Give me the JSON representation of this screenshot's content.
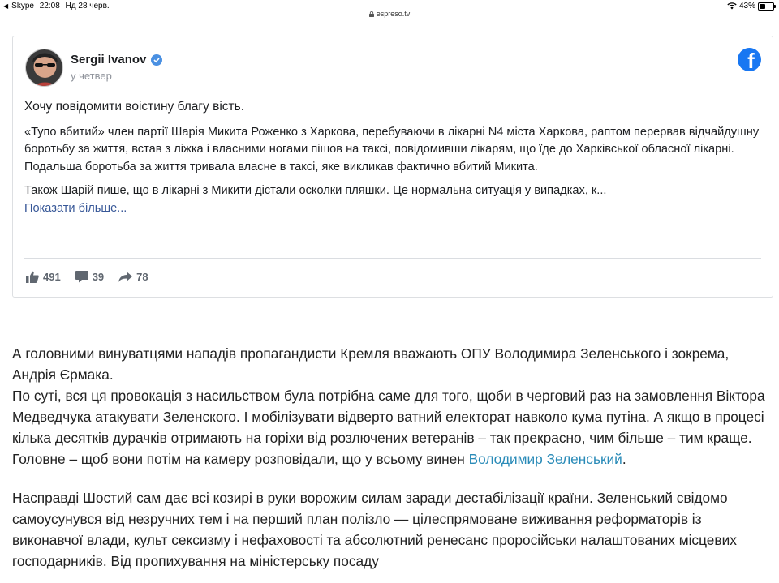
{
  "status_bar": {
    "back_app": "Skype",
    "time": "22:08",
    "date": "Нд 28 черв.",
    "battery": "43%",
    "url": "espreso.tv"
  },
  "fb_post": {
    "author": "Sergii Ivanov",
    "timestamp": "у четвер",
    "lead": "Хочу повідомити воістину благу вість.",
    "paragraph1": "«Тупо вбитий» член партії Шарія Микита Роженко з Харкова, перебуваючи в лікарні N4 міста Харкова, раптом перервав відчайдушну боротьбу за життя, встав з ліжка і власними ногами пішов на таксі, повідомивши лікарям, що їде до Харківської обласної лікарні. Подальша боротьба за життя тривала власне в таксі, яке викликав фактично вбитий Микита.",
    "paragraph2": "Також Шарій пише, що в лікарні з Микити дістали осколки пляшки. Це нормальна ситуація у випадках, к...",
    "show_more": "Показати більше...",
    "likes": "491",
    "comments": "39",
    "shares": "78",
    "brand_color": "#1877f2"
  },
  "article": {
    "p1_line1": "А головними винуватцями нападів пропагандисти Кремля вважають ОПУ Володимира Зеленського і зокрема, Андрія Єрмака.",
    "p1_rest": "По суті, вся ця провокація з насильством була потрібна саме для того, щоби в черговий раз на замовлення Віктора Медведчука атакувати Зеленского. І мобілізувати відверто ватний електорат навколо кума путіна. А якщо в процесі кілька десятків дурачків отримають на горіхи від розлючених ветеранів – так прекрасно, чим більше – тим краще. Головне – щоб вони потім на камеру розповідали, що у всьому винен ",
    "p1_link": "Володимир Зеленський",
    "p1_end": ".",
    "p2": "Насправді Шостий сам дає всі козирі в руки ворожим силам заради дестабілізації країни. Зеленський свідомо самоусунувся від незручних тем і на перший план полізло — цілеспрямоване виживання реформаторів із виконавчої влади, культ сексизму і нефаховості та абсолютний ренесанс проросійськи налаштованих місцевих господарників. Від пропихування на міністерську посаду",
    "link_color": "#2a8bb8"
  }
}
